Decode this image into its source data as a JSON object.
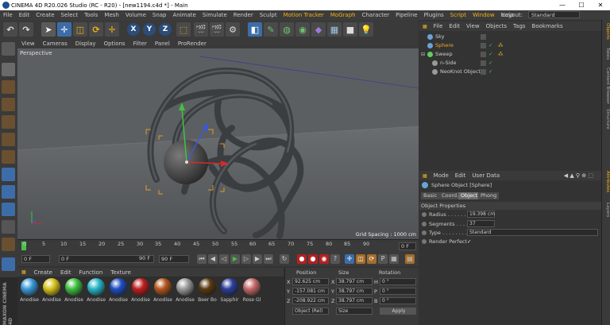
{
  "window": {
    "title": "CINEMA 4D R20.026 Studio (RC - R20) - [new1194.c4d *] - Main",
    "minimize": "—",
    "maximize": "☐",
    "close": "✕"
  },
  "menubar": {
    "items": [
      "File",
      "Edit",
      "Create",
      "Select",
      "Tools",
      "Mesh",
      "Volume",
      "Snap",
      "Animate",
      "Simulate",
      "Render",
      "Sculpt",
      "Motion Tracker",
      "MoGraph",
      "Character",
      "Pipeline",
      "Plugins",
      "Script",
      "Window",
      "Help"
    ],
    "layout_label": "Layout:",
    "layout_value": "Standard"
  },
  "toolbar": {
    "x": "X",
    "y": "Y",
    "z": "Z"
  },
  "viewport": {
    "menu": [
      "View",
      "Cameras",
      "Display",
      "Options",
      "Filter",
      "Panel",
      "ProRender"
    ],
    "camera": "Perspective",
    "grid_spacing": "Grid Spacing : 1000 cm"
  },
  "timeline": {
    "ticks": [
      "0",
      "5",
      "10",
      "15",
      "20",
      "25",
      "30",
      "35",
      "40",
      "45",
      "50",
      "55",
      "60",
      "65",
      "70",
      "75",
      "80",
      "85",
      "90"
    ],
    "end_frame": "0 F",
    "start_field": "0 F",
    "current_field": "0 F",
    "range_end": "90 F",
    "max_field": "90 F"
  },
  "materials": {
    "menu": [
      "Create",
      "Edit",
      "Function",
      "Texture"
    ],
    "items": [
      {
        "label": "Anodise",
        "color": "#3a9ad9"
      },
      {
        "label": "Anodise",
        "color": "#d6c21a"
      },
      {
        "label": "Anodise",
        "color": "#3fbf3f"
      },
      {
        "label": "Anodise",
        "color": "#27b6c8"
      },
      {
        "label": "Anodise",
        "color": "#1f4ec2"
      },
      {
        "label": "Anodise",
        "color": "#c01f1f"
      },
      {
        "label": "Anodise",
        "color": "#b5561e"
      },
      {
        "label": "Anodise",
        "color": "#9a9a9a"
      },
      {
        "label": "Beer Bo",
        "color": "#5a3a12"
      },
      {
        "label": "Sapphir",
        "color": "#2c3f9a"
      },
      {
        "label": "Rose Gl",
        "color": "#c46a6a"
      }
    ]
  },
  "coordinates": {
    "headers": {
      "position": "Position",
      "size": "Size",
      "rotation": "Rotation"
    },
    "rows": [
      {
        "axis": "X",
        "pos": "92.625 cm",
        "size_axis": "X",
        "size": "38.797 cm",
        "rot_axis": "H",
        "rot": "0 °"
      },
      {
        "axis": "Y",
        "pos": "-157.081 cm",
        "size_axis": "Y",
        "size": "38.797 cm",
        "rot_axis": "P",
        "rot": "0 °"
      },
      {
        "axis": "Z",
        "pos": "-208.922 cm",
        "size_axis": "Z",
        "size": "38.797 cm",
        "rot_axis": "B",
        "rot": "0 °"
      }
    ],
    "mode": "Object (Rel)",
    "size_mode": "Size",
    "apply": "Apply"
  },
  "objects": {
    "menu": [
      "File",
      "Edit",
      "View",
      "Objects",
      "Tags",
      "Bookmarks"
    ],
    "rows": [
      {
        "name": "Sky",
        "indent": 0,
        "icon_color": "#6aa2d8",
        "selected": false
      },
      {
        "name": "Sphere",
        "indent": 0,
        "icon_color": "#6aa2d8",
        "selected": true
      },
      {
        "name": "Sweep",
        "indent": 0,
        "icon_color": "#5fcf5f",
        "selected": false
      },
      {
        "name": "n-Side",
        "indent": 1,
        "icon_color": "#9a9a9a",
        "selected": false
      },
      {
        "name": "NeoKnot Object",
        "indent": 1,
        "icon_color": "#9a9a9a",
        "selected": false
      }
    ]
  },
  "attributes": {
    "menu": [
      "Mode",
      "Edit",
      "User Data"
    ],
    "object_title": "Sphere Object [Sphere]",
    "tabs": [
      "Basic",
      "Coord.",
      "Object",
      "Phong"
    ],
    "active_tab": "Object",
    "section": "Object Properties",
    "radius_label": "Radius . . . . . . .",
    "radius": "19.398 cm",
    "segments_label": "Segments . . . .",
    "segments": "37",
    "type_label": "Type . . . . . . . .",
    "type": "Standard",
    "perfect_label": "Render Perfect",
    "perfect": "✓"
  },
  "side_tabs": [
    "Objects",
    "Takes",
    "Content Browser",
    "Structure",
    "Attributes",
    "Layers"
  ],
  "brand": "MAXON CINEMA 4D",
  "colors": {
    "accent": "#f0b21a",
    "selection": "#f5a623",
    "panel": "#3a3a3a"
  }
}
